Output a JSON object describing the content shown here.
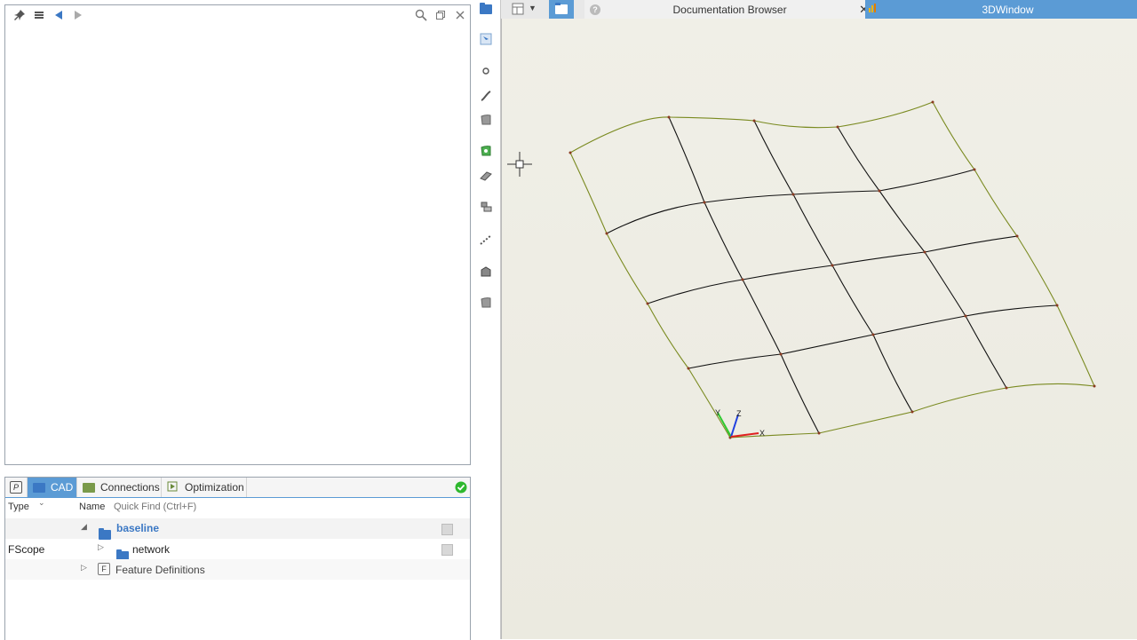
{
  "left_top_toolbar": {
    "icons": [
      "pin-icon",
      "menu-icon",
      "back-arrow-icon",
      "forward-arrow-icon",
      "search-icon",
      "restore-window-icon",
      "close-icon"
    ]
  },
  "bottom_panel": {
    "tabs": [
      {
        "label": "CAD",
        "active": true
      },
      {
        "label": "Connections",
        "active": false
      },
      {
        "label": "Optimization",
        "active": false
      }
    ],
    "status_color": "#2eb82e",
    "columns": {
      "type": "Type",
      "name": "Name"
    },
    "quick_find": {
      "placeholder": "Quick Find (Ctrl+F)"
    },
    "tree": [
      {
        "type": "",
        "label": "baseline",
        "bold": true
      },
      {
        "type": "FScope",
        "label": "network",
        "bold": false
      },
      {
        "type": "",
        "label": "Feature Definitions",
        "bold": false
      }
    ]
  },
  "right_tabs": {
    "doc_tab_title": "Documentation Browser",
    "window_tab_title": "3DWindow"
  },
  "viewport": {
    "background": "#efeee6",
    "boundary_color": "#7a8a20",
    "grid_color": "#111111",
    "axes": {
      "x": "X",
      "y": "Y",
      "z": "Z"
    }
  },
  "colors": {
    "accent": "#5b9bd5",
    "folder": "#3b78c4"
  }
}
